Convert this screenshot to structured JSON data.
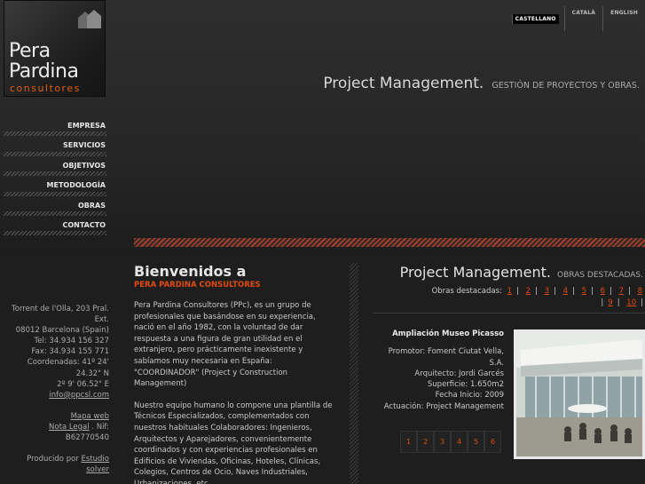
{
  "logo": {
    "line1": "Pera",
    "line2": "Pardina",
    "line3": "consultores"
  },
  "languages": [
    {
      "label": "CASTELLANO",
      "active": true
    },
    {
      "label": "CATALÀ",
      "active": false
    },
    {
      "label": "ENGLISH",
      "active": false
    }
  ],
  "header": {
    "title": "Project Management.",
    "subtitle": "GESTIÓN DE PROYECTOS Y OBRAS."
  },
  "menu": [
    "EMPRESA",
    "SERVICIOS",
    "OBJETIVOS",
    "METODOLOGÍA",
    "OBRAS",
    "CONTACTO"
  ],
  "address": {
    "line1": "Torrent de l'Olla, 203 Pral.",
    "line2": "Ext.",
    "line3": "08012 Barcelona (Spain)",
    "tel": "Tel: 34.934 156 327",
    "fax": "Fax: 34.934 155 771",
    "coords1": "Coordenadas: 41º 24'",
    "coords2": "24.32\" N",
    "coords3": "2º 9' 06.52\" E",
    "email": "info@ppcsl.com",
    "sitemap": "Mapa web",
    "legal": "Nota Legal",
    "nif": ". Nif:",
    "nif_value": "B62770540",
    "produced": "Producido por",
    "producer": "Estudio",
    "producer2": "solver"
  },
  "welcome": {
    "title": "Bienvenidos a",
    "subtitle": "PERA PARDINA CONSULTORES",
    "para1": "Pera Pardina Consultores (PPc), es un grupo de profesionales que basándose en su experiencia, nació en el año 1982, con la voluntad de dar respuesta a una figura de gran utilidad en el extranjero, pero prácticamente inexistente y sabíamos muy necesaria en España: \"COORDINADOR\" (Project y Construction Management)",
    "para2": "Nuestro equipo humano lo compone una plantilla de Técnicos Especializados, complementados con nuestros habituales Colaboradores: Ingenieros, Arquitectos y Aparejadores, convenientemente coordinados y con experiencias profesionales en Edificios de Viviendas, Oficinas, Hoteles, Clínicas, Colegios, Centros de Ocio, Naves Industriales, Urbanizaciones, etc."
  },
  "projects_section": {
    "title": "Project Management.",
    "subtitle": "OBRAS DESTACADAS.",
    "nav_label": "Obras destacadas:",
    "nav_numbers": [
      "1",
      "2",
      "3",
      "4",
      "5",
      "6",
      "7",
      "8",
      "9",
      "10"
    ]
  },
  "project": {
    "title": "Ampliación Museo Picasso",
    "promotor": "Promotor: Foment Ciutat Vella, S.A.",
    "arquitecto": "Arquitecto: Jordi Garcés",
    "superficie": "Superficie: 1.650m2",
    "fecha": "Fecha Inicio: 2009",
    "actuacion": "Actuación: Project Management"
  },
  "pager": [
    "1",
    "2",
    "3",
    "4",
    "5",
    "6"
  ]
}
